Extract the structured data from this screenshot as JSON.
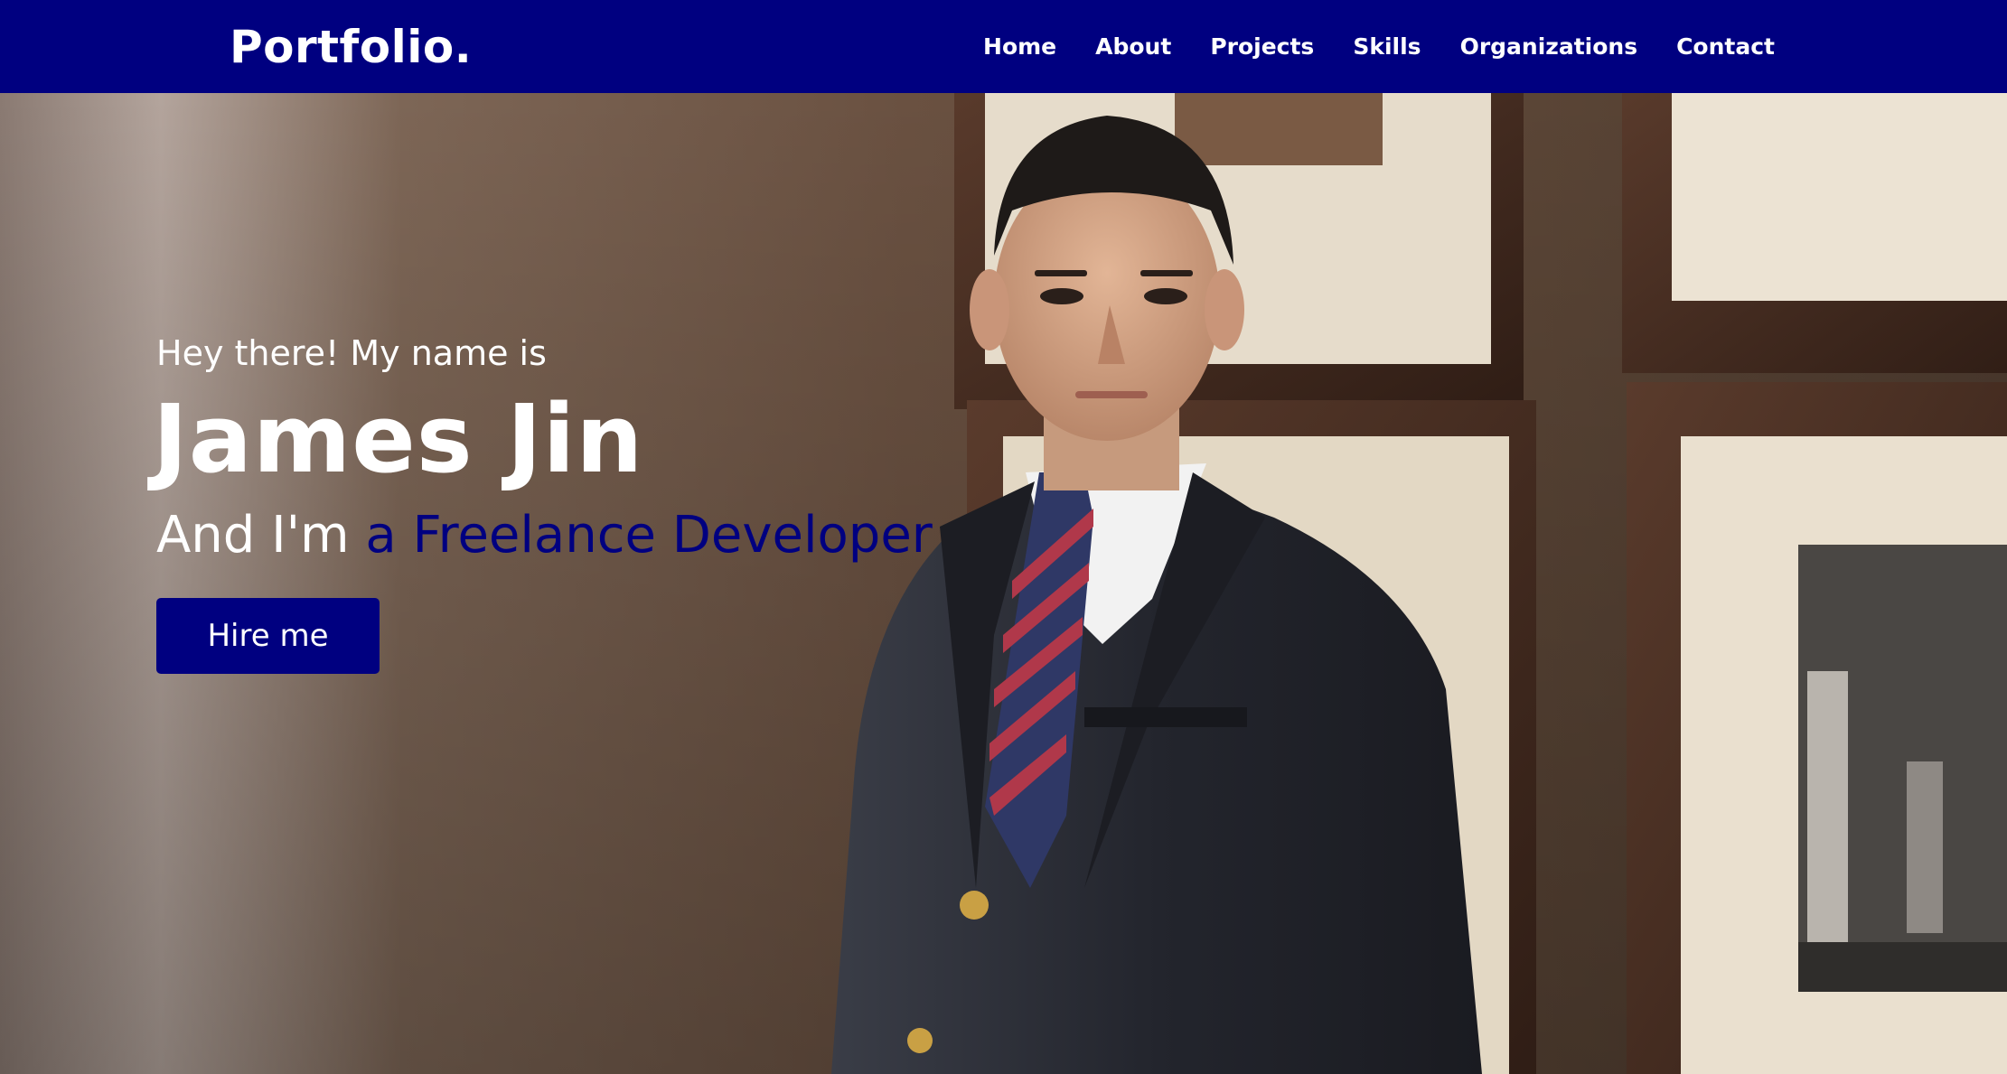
{
  "nav": {
    "logo": "Portfolio.",
    "items": [
      {
        "label": "Home"
      },
      {
        "label": "About"
      },
      {
        "label": "Projects"
      },
      {
        "label": "Skills"
      },
      {
        "label": "Organizations"
      },
      {
        "label": "Contact"
      }
    ]
  },
  "hero": {
    "greeting": "Hey there! My name is",
    "name": "James Jin",
    "role_prefix": "And I'm ",
    "role": "a Freelance Developer",
    "cta_label": "Hire me",
    "photo_subject": "portrait-photo"
  },
  "colors": {
    "brand": "#000080",
    "text_light": "#ffffff"
  }
}
